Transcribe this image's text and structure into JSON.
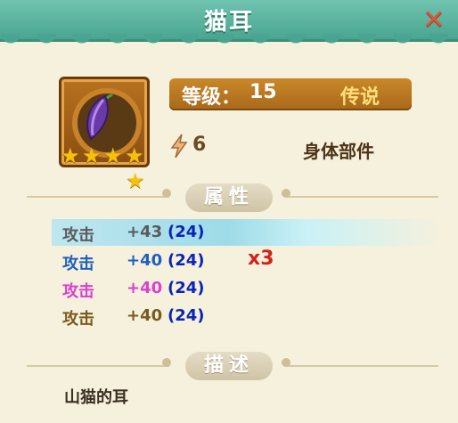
{
  "header": {
    "title": "猫耳",
    "close_icon": "close-x-icon"
  },
  "item": {
    "icon": "purple-leaf-item-icon",
    "stars": 4,
    "bonus_stars": 1,
    "level_label": "等级：",
    "level": "15",
    "rarity": "传说",
    "power": "6",
    "slot": "身体部件"
  },
  "sections": {
    "attributes": "属性",
    "description": "描述"
  },
  "stats": [
    {
      "name": "攻击",
      "value": "+43",
      "base": "(24)",
      "name_color": "#5b5b5b",
      "value_color": "#5b5b5b",
      "highlight": true
    },
    {
      "name": "攻击",
      "value": "+40",
      "base": "(24)",
      "name_color": "#1f5fbf",
      "value_color": "#1f5fbf",
      "highlight": false
    },
    {
      "name": "攻击",
      "value": "+40",
      "base": "(24)",
      "name_color": "#d93fd0",
      "value_color": "#d93fd0",
      "highlight": false
    },
    {
      "name": "攻击",
      "value": "+40",
      "base": "(24)",
      "name_color": "#7a5a1e",
      "value_color": "#7a5a1e",
      "highlight": false
    }
  ],
  "multiplier": "x3",
  "description": "山猫的耳",
  "colors": {
    "header": "#4aa590",
    "accent_gold": "#c98829",
    "rarity": "#ffdf7a",
    "multiplier": "#d4221a"
  }
}
